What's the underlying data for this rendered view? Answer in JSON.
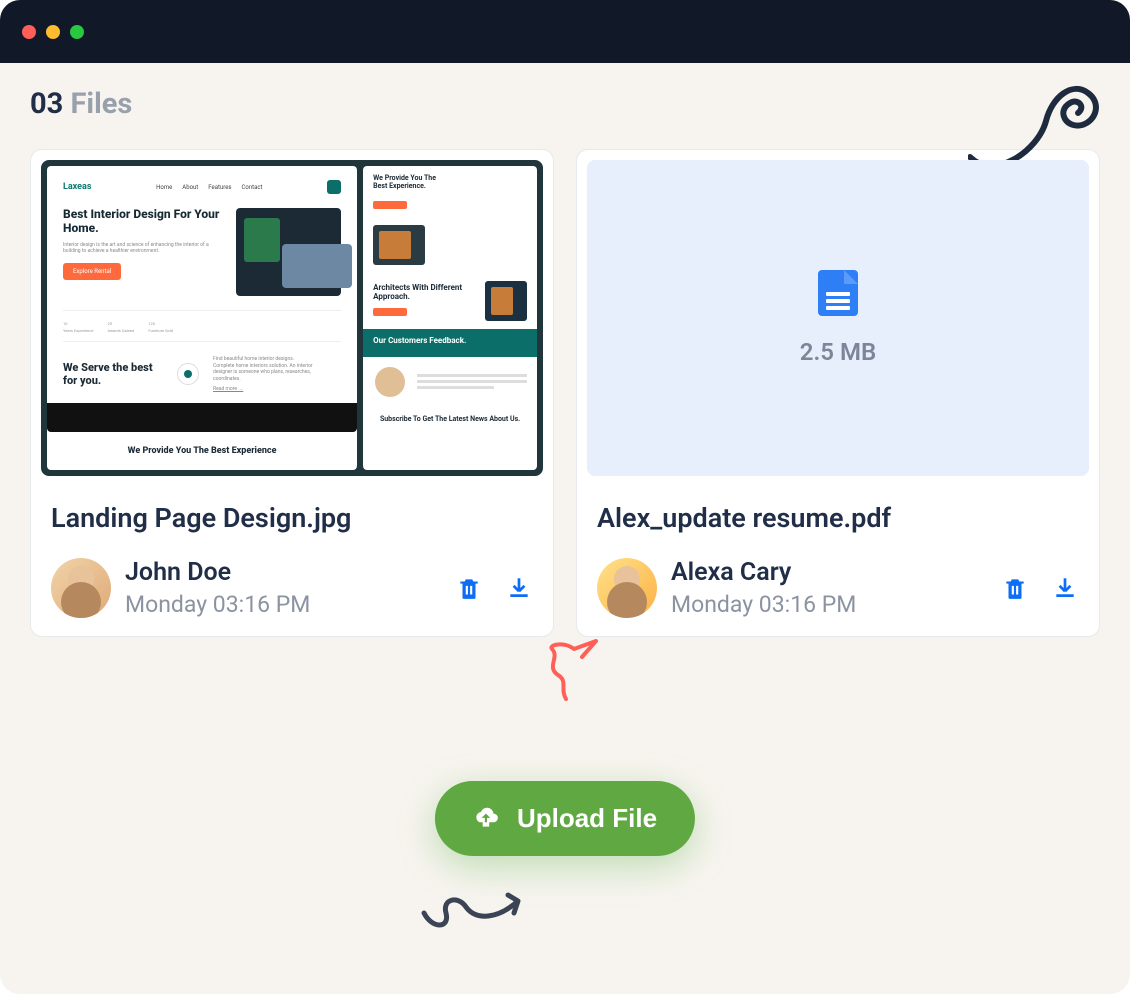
{
  "header": {
    "count_prefix": "03",
    "title": " Files"
  },
  "upload": {
    "label": "Upload File"
  },
  "cards": [
    {
      "title": "Landing Page Design.jpg",
      "user": "John Doe",
      "date": "Monday 03:16 PM",
      "thumb": {
        "brand": "Laxeas",
        "nav": [
          "Home",
          "About",
          "Features",
          "Contact"
        ],
        "hero_title": "Best Interior Design For Your Home.",
        "hero_sub": "Interior design is the art and science of enhancing the interior of a building to achieve a healthier environment.",
        "hero_btn": "Explore Rental",
        "stats": [
          [
            "10",
            "Years Experience"
          ],
          [
            "25",
            "Awards Gained"
          ],
          [
            "120",
            "Furniture Sold"
          ]
        ],
        "serve_title": "We Serve the best for you.",
        "serve_desc": "Find beautiful home interior designs. Complete home interiors solution. An interior designer is someone who plans, researches, coordinates.",
        "read_more": "Read more →",
        "serve_cta": "We Provide You The Best Experience",
        "r_top": "We Provide You The\nBest Experience.",
        "r_arch": "Architects With Different Approach.",
        "r_feedback": "Our Customers Feedback.",
        "r_sub": "Subscribe To Get The Latest News About Us."
      }
    },
    {
      "title": "Alex_update resume.pdf",
      "user": "Alexa Cary",
      "date": "Monday 03:16 PM",
      "size": "2.5 MB"
    }
  ]
}
